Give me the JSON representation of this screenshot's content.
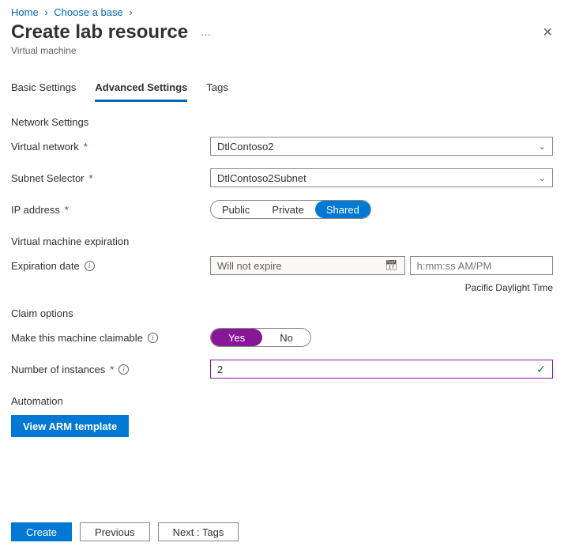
{
  "breadcrumb": {
    "home": "Home",
    "choose": "Choose a base"
  },
  "header": {
    "title": "Create lab resource",
    "subtitle": "Virtual machine"
  },
  "tabs": {
    "basic": "Basic Settings",
    "advanced": "Advanced Settings",
    "tags": "Tags"
  },
  "network": {
    "section": "Network Settings",
    "vnet_label": "Virtual network",
    "vnet_value": "DtlContoso2",
    "subnet_label": "Subnet Selector",
    "subnet_value": "DtlContoso2Subnet",
    "ip_label": "IP address",
    "ip_options": {
      "public": "Public",
      "private": "Private",
      "shared": "Shared"
    }
  },
  "expiration": {
    "section": "Virtual machine expiration",
    "label": "Expiration date",
    "date_value": "Will not expire",
    "time_placeholder": "h:mm:ss AM/PM",
    "tz": "Pacific Daylight Time"
  },
  "claim": {
    "section": "Claim options",
    "claim_label": "Make this machine claimable",
    "yes": "Yes",
    "no": "No",
    "instances_label": "Number of instances",
    "instances_value": "2"
  },
  "automation": {
    "section": "Automation",
    "arm_button": "View ARM template"
  },
  "footer": {
    "create": "Create",
    "previous": "Previous",
    "next": "Next : Tags"
  }
}
